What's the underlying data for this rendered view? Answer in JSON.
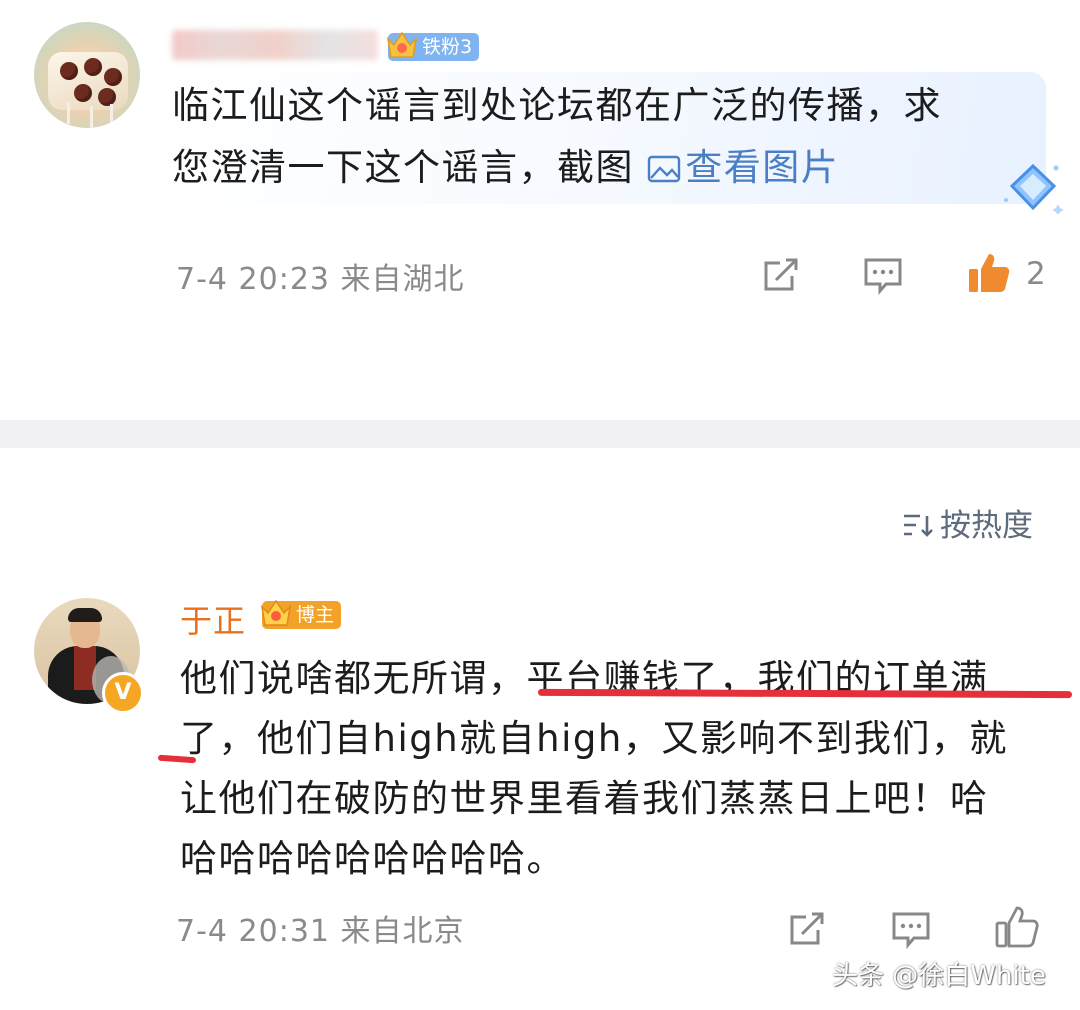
{
  "comment1": {
    "author_badge": "铁粉3",
    "text_line1": "临江仙这个谣言到处论坛都在广泛的传播，求",
    "text_line2_prefix": "您澄清一下这个谣言，截图",
    "image_link": "查看图片",
    "time": "7-4 20:23",
    "location": "来自湖北",
    "likes": "2",
    "liked": true,
    "colors": {
      "like_active": "#f08a2e",
      "link": "#4b7fc5"
    }
  },
  "sort": {
    "label": "按热度"
  },
  "comment2": {
    "author": "于正",
    "author_badge": "博主",
    "verified_mark": "V",
    "lines": [
      {
        "normal": "他们说啥都无所谓，",
        "highlight": "平台赚钱了，我们的订单满"
      },
      {
        "normal": "了，他们自high就自high，又影响不到我们，就"
      },
      {
        "normal": "让他们在破防的世界里看着我们蒸蒸日上吧！哈"
      },
      {
        "normal": "哈哈哈哈哈哈哈哈哈。"
      }
    ],
    "time": "7-4 20:31",
    "location": "来自北京",
    "colors": {
      "author": "#e8711f",
      "underline": "#e5303b"
    }
  },
  "watermark": "头条 @徐白White"
}
